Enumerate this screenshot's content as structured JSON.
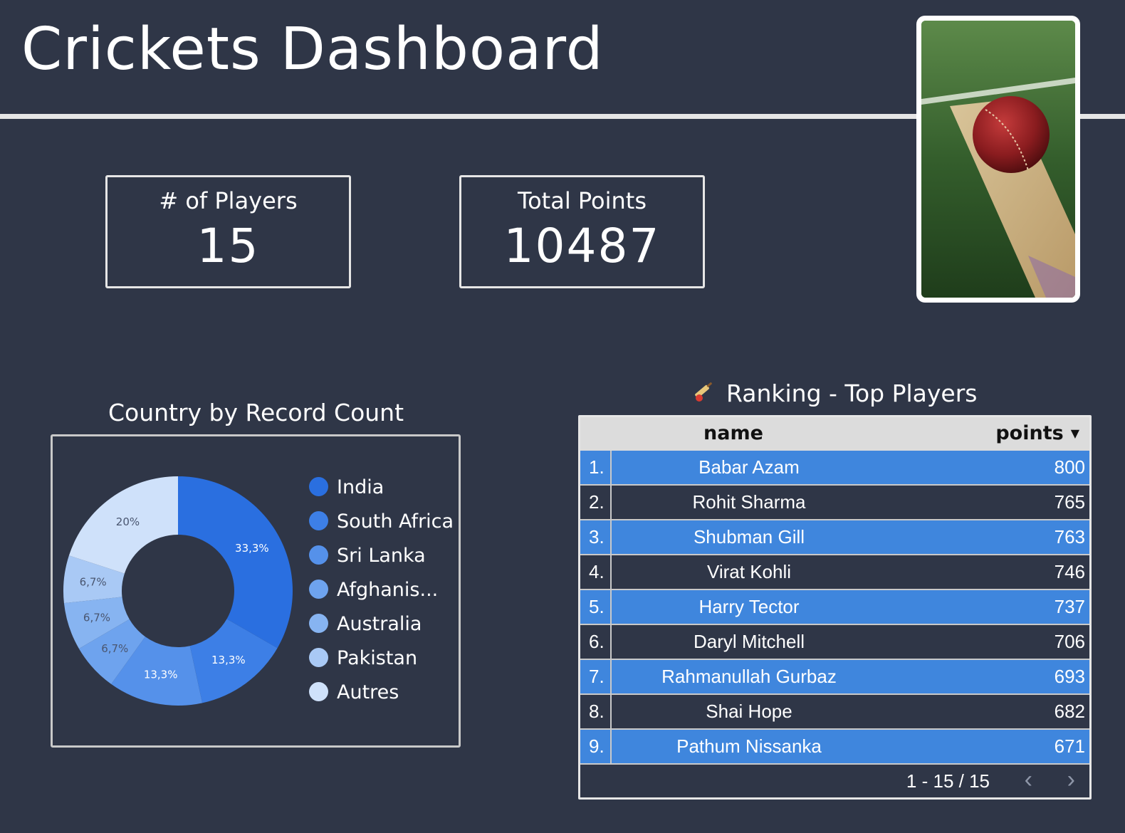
{
  "header": {
    "title": "Crickets Dashboard"
  },
  "kpis": {
    "players_label": "# of Players",
    "players_value": "15",
    "points_label": "Total Points",
    "points_value": "10487"
  },
  "donut": {
    "title": "Country by Record Count"
  },
  "chart_data": {
    "type": "pie",
    "title": "Country by Record Count",
    "donut": true,
    "legend_position": "right",
    "slices": [
      {
        "label": "India",
        "value": 33.3,
        "display": "33,3%",
        "color": "#2a6fe0"
      },
      {
        "label": "South Africa",
        "value": 13.3,
        "display": "13,3%",
        "color": "#3d7fe6"
      },
      {
        "label": "Sri Lanka",
        "value": 13.3,
        "display": "13,3%",
        "color": "#5591ea"
      },
      {
        "label": "Afghanis...",
        "value": 6.7,
        "display": "6,7%",
        "color": "#6ea3ee"
      },
      {
        "label": "Australia",
        "value": 6.7,
        "display": "6,7%",
        "color": "#87b4f1"
      },
      {
        "label": "Pakistan",
        "value": 6.7,
        "display": "6,7%",
        "color": "#a9c9f5"
      },
      {
        "label": "Autres",
        "value": 20,
        "display": "20%",
        "color": "#cfe1fa"
      }
    ]
  },
  "legend": {
    "items": [
      {
        "label": "India",
        "color": "#2a6fe0"
      },
      {
        "label": "South Africa",
        "color": "#3d7fe6"
      },
      {
        "label": "Sri Lanka",
        "color": "#5591ea"
      },
      {
        "label": "Afghanis...",
        "color": "#6ea3ee"
      },
      {
        "label": "Australia",
        "color": "#87b4f1"
      },
      {
        "label": "Pakistan",
        "color": "#a9c9f5"
      },
      {
        "label": "Autres",
        "color": "#cfe1fa"
      }
    ]
  },
  "ranking": {
    "title": "Ranking - Top Players",
    "icon": "cricket-bat-icon",
    "columns": {
      "name": "name",
      "points": "points",
      "sort_icon": "▼"
    },
    "rows": [
      {
        "idx": "1.",
        "name": "Babar Azam",
        "points": "800"
      },
      {
        "idx": "2.",
        "name": "Rohit Sharma",
        "points": "765"
      },
      {
        "idx": "3.",
        "name": "Shubman Gill",
        "points": "763"
      },
      {
        "idx": "4.",
        "name": "Virat Kohli",
        "points": "746"
      },
      {
        "idx": "5.",
        "name": "Harry Tector",
        "points": "737"
      },
      {
        "idx": "6.",
        "name": "Daryl Mitchell",
        "points": "706"
      },
      {
        "idx": "7.",
        "name": "Rahmanullah Gurbaz",
        "points": "693"
      },
      {
        "idx": "8.",
        "name": "Shai Hope",
        "points": "682"
      },
      {
        "idx": "9.",
        "name": "Pathum Nissanka",
        "points": "671"
      }
    ],
    "pager": {
      "text": "1 - 15 / 15",
      "prev": "‹",
      "next": "›"
    }
  },
  "colors": {
    "background": "#2f3647",
    "row_highlight": "#3f86dd",
    "header_bg": "#dcdcdc"
  }
}
